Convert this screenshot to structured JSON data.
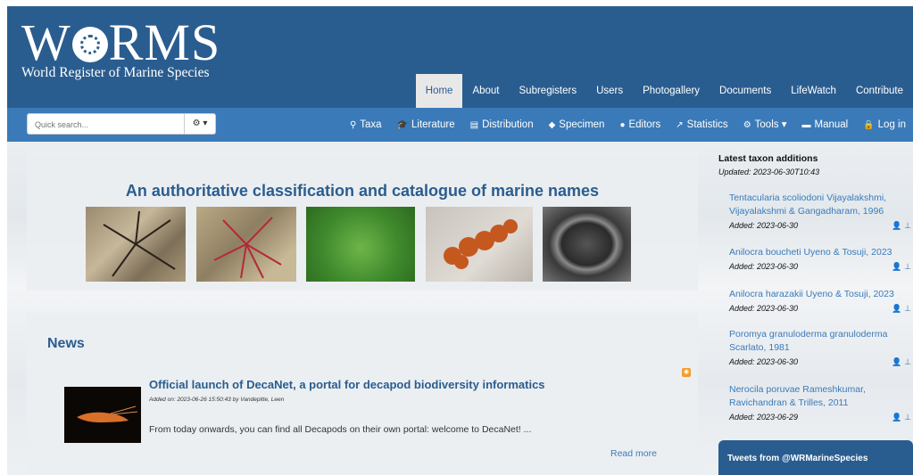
{
  "header": {
    "logo_main": "WoRMS",
    "logo_sub": "World Register of Marine Species",
    "tabs": [
      {
        "label": "Home",
        "active": true
      },
      {
        "label": "About"
      },
      {
        "label": "Subregisters"
      },
      {
        "label": "Users"
      },
      {
        "label": "Photogallery"
      },
      {
        "label": "Documents"
      },
      {
        "label": "LifeWatch"
      },
      {
        "label": "Contribute"
      }
    ]
  },
  "subbar": {
    "search_placeholder": "Quick search...",
    "search_options_icon": "gear-icon",
    "items": [
      {
        "label": "Taxa",
        "icon": "search-icon"
      },
      {
        "label": "Literature",
        "icon": "graduation-cap-icon"
      },
      {
        "label": "Distribution",
        "icon": "map-icon"
      },
      {
        "label": "Specimen",
        "icon": "tag-icon"
      },
      {
        "label": "Editors",
        "icon": "users-icon"
      },
      {
        "label": "Statistics",
        "icon": "line-chart-icon"
      },
      {
        "label": "Tools",
        "icon": "gears-icon"
      },
      {
        "label": "Manual",
        "icon": "book-icon"
      },
      {
        "label": "Log in",
        "icon": "lock-icon"
      }
    ]
  },
  "hero": {
    "title": "An authoritative classification and catalogue of marine names"
  },
  "news": {
    "heading": "News",
    "items": [
      {
        "title": "Official launch of DecaNet, a portal for decapod biodiversity informatics",
        "meta": "Added on: 2023-06-26 15:50:43 by Vandepitte, Leen",
        "body": "From today onwards, you can find all Decapods on their own portal: welcome to DecaNet! ...",
        "read_more": "Read more"
      }
    ]
  },
  "sidebar": {
    "heading": "Latest taxon additions",
    "updated": "Updated: 2023-06-30T10:43",
    "taxa": [
      {
        "name": "Tentacularia scoliodoni Vijayalakshmi, Vijayalakshmi & Gangadharam, 1996",
        "added": "Added: 2023-06-30"
      },
      {
        "name": "Anilocra boucheti Uyeno & Tosuji, 2023",
        "added": "Added: 2023-06-30"
      },
      {
        "name": "Anilocra harazakii Uyeno & Tosuji, 2023",
        "added": "Added: 2023-06-30"
      },
      {
        "name": "Poromya granuloderma granuloderma Scarlato, 1981",
        "added": "Added: 2023-06-30"
      },
      {
        "name": "Nerocila poruvae Rameshkumar, Ravichandran & Trilles, 2011",
        "added": "Added: 2023-06-29"
      }
    ],
    "tweets_title": "Tweets from @WRMarineSpecies"
  },
  "colors": {
    "header_bg": "#2a5d8f",
    "subbar_bg": "#3b7ab8",
    "accent_text": "#2a5d8f",
    "link": "#3b7ab8"
  }
}
